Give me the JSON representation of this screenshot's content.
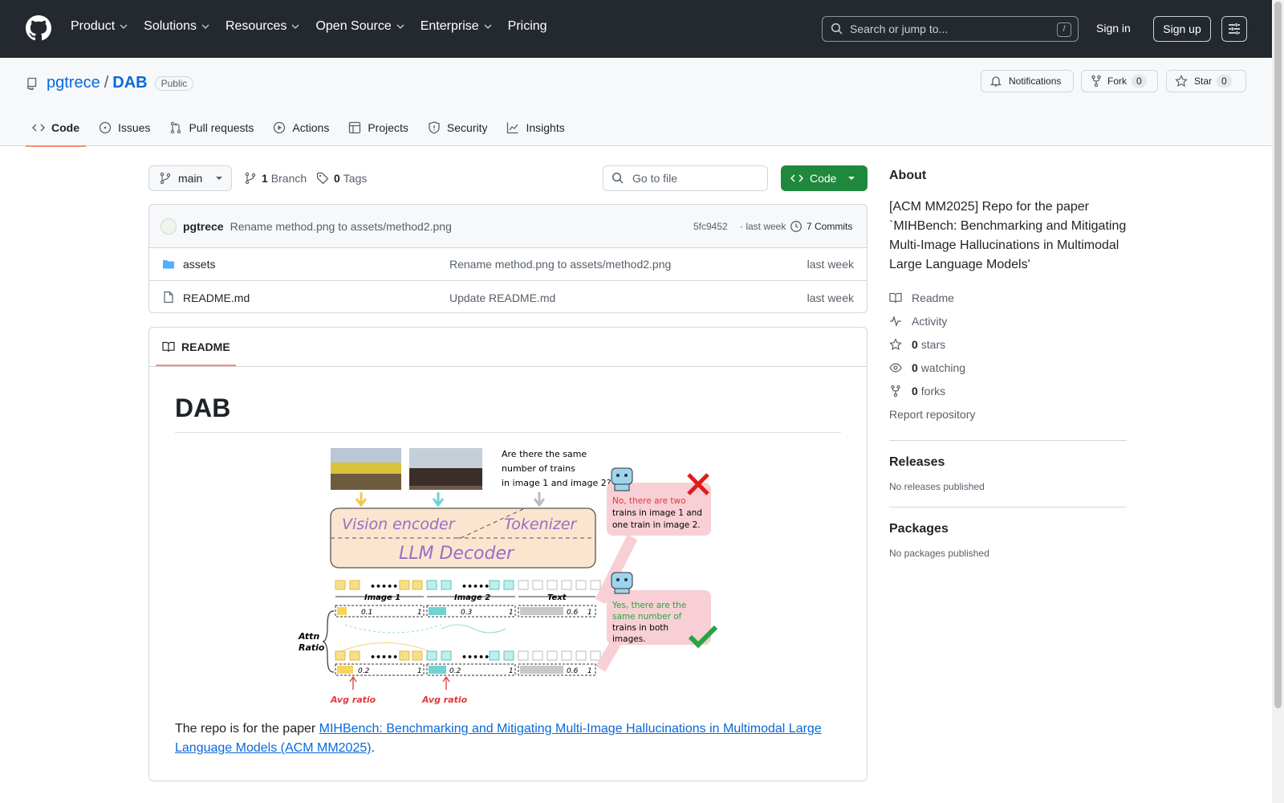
{
  "header": {
    "nav": [
      "Product",
      "Solutions",
      "Resources",
      "Open Source",
      "Enterprise",
      "Pricing"
    ],
    "search_placeholder": "Search or jump to...",
    "search_key": "/",
    "sign_in": "Sign in",
    "sign_up": "Sign up"
  },
  "repo": {
    "owner": "pgtrece",
    "separator": "/",
    "name": "DAB",
    "visibility": "Public",
    "notifications_label": "Notifications",
    "fork_label": "Fork",
    "fork_count": "0",
    "star_label": "Star",
    "star_count": "0"
  },
  "tabs": [
    "Code",
    "Issues",
    "Pull requests",
    "Actions",
    "Projects",
    "Security",
    "Insights"
  ],
  "toolbar": {
    "branch": "main",
    "branch_count": "1",
    "branch_label": "Branch",
    "tag_count": "0",
    "tag_label": "Tags",
    "goto_file": "Go to file",
    "code_button": "Code"
  },
  "commit": {
    "author": "pgtrece",
    "message": "Rename method.png to assets/method2.png",
    "hash": "5fc9452",
    "time": "· last week",
    "commits": "7 Commits"
  },
  "files": [
    {
      "name": "assets",
      "type": "folder",
      "message": "Rename method.png to assets/method2.png",
      "time": "last week"
    },
    {
      "name": "README.md",
      "type": "file",
      "message": "Update README.md",
      "time": "last week"
    }
  ],
  "readme": {
    "tab_label": "README",
    "title": "DAB",
    "para_prefix": "The repo is for the paper ",
    "link_text": "MIHBench: Benchmarking and Mitigating Multi-Image Hallucinations in Multimodal Large Language Models (ACM MM2025)",
    "para_suffix": ".",
    "figure": {
      "question": [
        "Are there the same",
        "number of trains",
        "in image 1 and image 2?"
      ],
      "vision_encoder": "Vision  encoder",
      "tokenizer": "Tokenizer",
      "decoder": "LLM   Decoder",
      "image1": "Image 1",
      "image2": "Image 2",
      "text": "Text",
      "attn_ratio": [
        "Attn",
        "Ratio"
      ],
      "avg_ratio": "Avg ratio",
      "top_vals": [
        "0.1",
        "1",
        "0.3",
        "1",
        "0.6",
        "1"
      ],
      "bot_vals": [
        "0.2",
        "1",
        "0.2",
        "1",
        "0.6",
        "1"
      ],
      "answer_no": [
        "No, there are two",
        "trains in image 1 and",
        "one train in image 2."
      ],
      "answer_yes": [
        "Yes, there are the",
        "same number of",
        "trains in both",
        "images."
      ]
    }
  },
  "about": {
    "heading": "About",
    "description": "[ACM MM2025] Repo for the paper `MIHBench: Benchmarking and Mitigating Multi-Image Hallucinations in Multimodal Large Language Models'",
    "readme": "Readme",
    "activity": "Activity",
    "stars_count": "0",
    "stars_label": "stars",
    "watching_count": "0",
    "watching_label": "watching",
    "forks_count": "0",
    "forks_label": "forks",
    "report": "Report repository"
  },
  "releases": {
    "heading": "Releases",
    "text": "No releases published"
  },
  "packages": {
    "heading": "Packages",
    "text": "No packages published"
  }
}
